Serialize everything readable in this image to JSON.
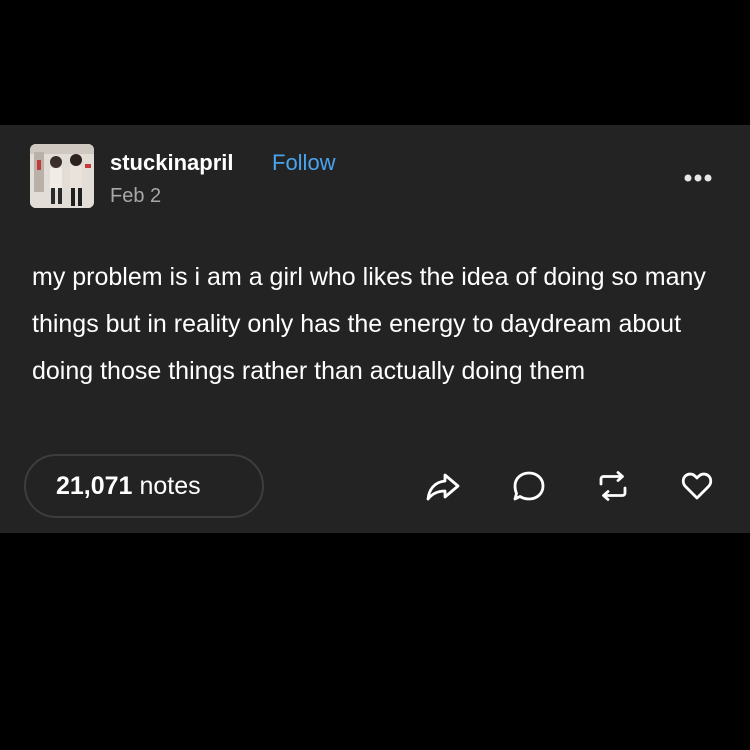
{
  "post": {
    "username": "stuckinapril",
    "follow_label": "Follow",
    "date": "Feb 2",
    "body": "my problem is i am a girl who likes the idea of doing so many things but in reality only has the energy to daydream about doing those things rather than actually doing them",
    "notes_count": "21,071",
    "notes_label": "notes"
  },
  "icons": {
    "more": "more-options-icon",
    "share": "share-icon",
    "reply": "reply-icon",
    "reblog": "reblog-icon",
    "like": "heart-icon"
  },
  "colors": {
    "background": "#000000",
    "card": "#232323",
    "text": "#ffffff",
    "muted": "#a8a8a8",
    "link": "#4aa3ef"
  }
}
